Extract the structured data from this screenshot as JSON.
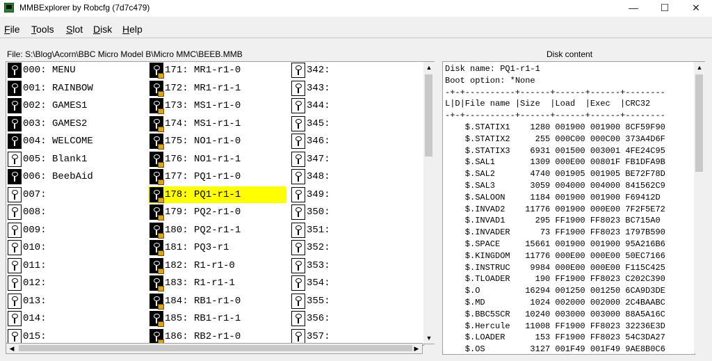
{
  "window": {
    "title": "MMBExplorer by Robcfg (7d7c479)",
    "minimize": "—",
    "maximize": "☐",
    "close": "✕"
  },
  "menu": {
    "file": {
      "ul": "F",
      "rest": "ile"
    },
    "tools": {
      "ul": "T",
      "rest": "ools"
    },
    "slot": {
      "ul": "S",
      "rest": "lot"
    },
    "disk": {
      "ul": "D",
      "rest": "isk"
    },
    "help": {
      "ul": "H",
      "rest": "elp"
    }
  },
  "file_path": "File: S:\\Blog\\Acorn\\BBC Micro Model B\\Micro MMC\\BEEB.MMB",
  "disk_content_title": "Disk content",
  "slots": {
    "columns": [
      [
        {
          "text": "000: MENU",
          "state": "filled"
        },
        {
          "text": "001: RAINBOW",
          "state": "filled"
        },
        {
          "text": "002: GAMES1",
          "state": "filled"
        },
        {
          "text": "003: GAMES2",
          "state": "filled"
        },
        {
          "text": "004: WELCOME",
          "state": "filled"
        },
        {
          "text": "005: Blank1",
          "state": "empty"
        },
        {
          "text": "006: BeebAid",
          "state": "filled"
        },
        {
          "text": "007:",
          "state": "empty"
        },
        {
          "text": "008:",
          "state": "empty"
        },
        {
          "text": "009:",
          "state": "empty"
        },
        {
          "text": "010:",
          "state": "empty"
        },
        {
          "text": "011:",
          "state": "empty"
        },
        {
          "text": "012:",
          "state": "empty"
        },
        {
          "text": "013:",
          "state": "empty"
        },
        {
          "text": "014:",
          "state": "empty"
        },
        {
          "text": "015:",
          "state": "empty"
        }
      ],
      [
        {
          "text": "171: MR1-r1-0",
          "state": "locked"
        },
        {
          "text": "172: MR1-r1-1",
          "state": "locked"
        },
        {
          "text": "173: MS1-r1-0",
          "state": "locked"
        },
        {
          "text": "174: MS1-r1-1",
          "state": "locked"
        },
        {
          "text": "175: NO1-r1-0",
          "state": "locked"
        },
        {
          "text": "176: NO1-r1-1",
          "state": "locked"
        },
        {
          "text": "177: PQ1-r1-0",
          "state": "locked"
        },
        {
          "text": "178: PQ1-r1-1",
          "state": "locked",
          "selected": true
        },
        {
          "text": "179: PQ2-r1-0",
          "state": "locked"
        },
        {
          "text": "180: PQ2-r1-1",
          "state": "locked"
        },
        {
          "text": "181: PQ3-r1",
          "state": "locked"
        },
        {
          "text": "182: R1-r1-0",
          "state": "locked"
        },
        {
          "text": "183: R1-r1-1",
          "state": "locked"
        },
        {
          "text": "184: RB1-r1-0",
          "state": "locked"
        },
        {
          "text": "185: RB1-r1-1",
          "state": "locked"
        },
        {
          "text": "186: RB2-r1-0",
          "state": "locked"
        }
      ],
      [
        {
          "text": "342:",
          "state": "empty"
        },
        {
          "text": "343:",
          "state": "empty"
        },
        {
          "text": "344:",
          "state": "empty"
        },
        {
          "text": "345:",
          "state": "empty"
        },
        {
          "text": "346:",
          "state": "empty"
        },
        {
          "text": "347:",
          "state": "empty"
        },
        {
          "text": "348:",
          "state": "empty"
        },
        {
          "text": "349:",
          "state": "empty"
        },
        {
          "text": "350:",
          "state": "empty"
        },
        {
          "text": "351:",
          "state": "empty"
        },
        {
          "text": "352:",
          "state": "empty"
        },
        {
          "text": "353:",
          "state": "empty"
        },
        {
          "text": "354:",
          "state": "empty"
        },
        {
          "text": "355:",
          "state": "empty"
        },
        {
          "text": "356:",
          "state": "empty"
        },
        {
          "text": "357:",
          "state": "empty"
        }
      ]
    ]
  },
  "disk": {
    "lines": [
      "Disk name: PQ1-r1-1",
      "Boot option: *None",
      "-+-+----------+------+------+------+--------",
      "L|D|File name |Size  |Load  |Exec  |CRC32",
      "-+-+----------+------+------+------+--------",
      "    $.STATIX1    1280 001900 001900 8CF59F90",
      "    $.STATIX2     255 000C00 000C00 373A4D6F",
      "    $.STATIX3    6931 001500 003001 4FE24C95",
      "    $.SAL1       1309 000E00 00801F FB1DFA9B",
      "    $.SAL2       4740 001905 001905 BE72F78D",
      "    $.SAL3       3059 004000 004000 841562C9",
      "    $.SALOON     1184 001900 001900 F69412D",
      "    $.INVAD2    11776 001900 000E00 7F2F5E72",
      "    $.INVAD1      295 FF1900 FF8023 BC715A0",
      "    $.INVADER      73 FF1900 FF8023 1797B590",
      "    $.SPACE     15661 001900 001900 95A216B6",
      "    $.KINGDOM   11776 000E00 000E00 50EC7166",
      "    $.INSTRUC    9984 000E00 000E00 F115C425",
      "    $.TLOADER     190 FF1900 FF8023 C202C390",
      "    $.O         16294 001250 001250 6CA9D3DE",
      "    $.MD         1024 002000 002000 2C4BAABC",
      "    $.BBC5SCR   10240 003000 003000 88A5A16C",
      "    $.Hercule   11008 FF1900 FF8023 32236E3D",
      "    $.LOADER      153 FF1900 FF8023 54C3DA27",
      "    $.OS         3127 001F49 001F49 9AE8B0C6"
    ]
  }
}
